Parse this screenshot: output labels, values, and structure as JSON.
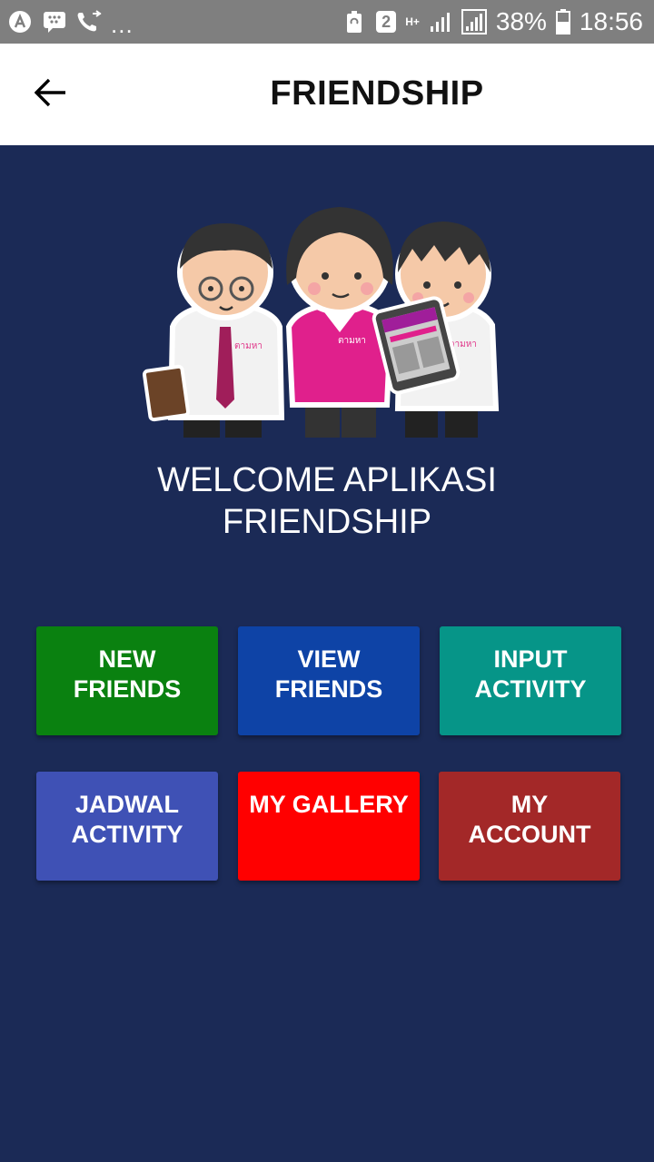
{
  "status_bar": {
    "battery_percent": "38%",
    "time": "18:56",
    "notification_badge": "2",
    "network_type": "H+",
    "overflow": "...",
    "icons": [
      "android-icon",
      "bbm-icon",
      "wifi-call-icon",
      "battery-saver-icon",
      "signal-icon",
      "signal-icon-2",
      "battery-icon"
    ]
  },
  "app_bar": {
    "title": "FRIENDSHIP",
    "back_icon": "arrow-back-icon"
  },
  "hero": {
    "illustration": "three-cartoon-students-illustration",
    "welcome_line1": "WELCOME APLIKASI",
    "welcome_line2": "FRIENDSHIP"
  },
  "menu": {
    "tiles": [
      {
        "line1": "NEW",
        "line2": "FRIENDS",
        "color": "#0a8110"
      },
      {
        "line1": "VIEW",
        "line2": "FRIENDS",
        "color": "#0e43a6"
      },
      {
        "line1": "INPUT",
        "line2": "ACTIVITY",
        "color": "#069588"
      },
      {
        "line1": "JADWAL",
        "line2": "ACTIVITY",
        "color": "#3f51b5"
      },
      {
        "line1": "MY GALLERY",
        "line2": "",
        "color": "#ff0000"
      },
      {
        "line1": "MY",
        "line2": "ACCOUNT",
        "color": "#a32828"
      }
    ]
  },
  "colors": {
    "background": "#1b2a56",
    "status_bar": "#7f7f7f",
    "app_bar": "#ffffff"
  }
}
